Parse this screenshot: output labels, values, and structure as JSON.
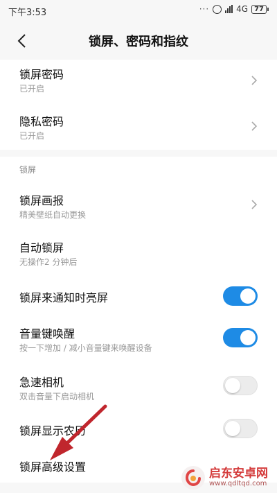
{
  "status": {
    "time": "下午3:53",
    "dots": "···",
    "network": "4G",
    "network_sup": "ll",
    "battery": "77"
  },
  "header": {
    "title": "锁屏、密码和指纹",
    "back_icon": "chevron-left-icon"
  },
  "items": [
    {
      "title": "锁屏密码",
      "sub": "已开启",
      "control": "chevron"
    },
    {
      "title": "隐私密码",
      "sub": "已开启",
      "control": "chevron"
    },
    {
      "title": "锁屏画报",
      "sub": "精美壁纸自动更换",
      "control": "chevron"
    },
    {
      "title": "自动锁屏",
      "sub": "无操作2 分钟后",
      "control": "none"
    },
    {
      "title": "锁屏来通知时亮屏",
      "sub": "",
      "control": "toggle",
      "on": true
    },
    {
      "title": "音量键唤醒",
      "sub": "按一下增加 / 减小音量键来唤醒设备",
      "control": "toggle",
      "on": true
    },
    {
      "title": "急速相机",
      "sub": "双击音量下启动相机",
      "control": "toggle",
      "on": false
    },
    {
      "title": "锁屏显示农历",
      "sub": "",
      "control": "toggle",
      "on": false
    },
    {
      "title": "锁屏高级设置",
      "sub": "",
      "control": "none"
    }
  ],
  "section_label": "锁屏",
  "colors": {
    "accent": "#1e8be5",
    "arrow": "#c0262d",
    "background": "#f7f7f7"
  },
  "watermark": {
    "name": "启东安卓网",
    "url": "www.qdltqd.com"
  }
}
